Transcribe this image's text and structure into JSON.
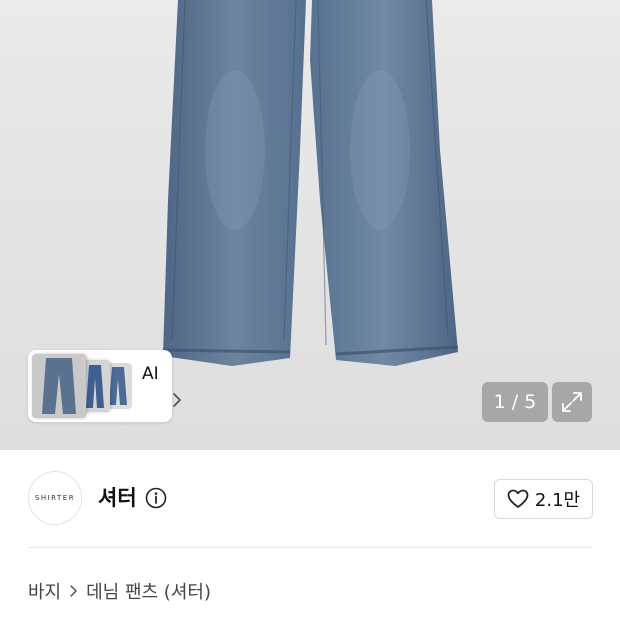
{
  "gallery": {
    "counter_text": "1 / 5",
    "ai_label": "AI",
    "chevron": "›",
    "colors": {
      "denim": "#5d7593",
      "denim_dark": "#4a5f7c",
      "background": "#e4e4e4"
    },
    "icons": {
      "expand": "expand-icon",
      "chevron": "chevron-right-icon"
    }
  },
  "brand": {
    "logo_text": "SHIRTER",
    "name": "셔터",
    "icons": {
      "info": "info-icon",
      "heart": "heart-icon"
    }
  },
  "like": {
    "count": "2.1만"
  },
  "breadcrumb": {
    "items": [
      "바지",
      "데님 팬츠 (셔터)"
    ],
    "separator_icon": "chevron-right-icon"
  }
}
